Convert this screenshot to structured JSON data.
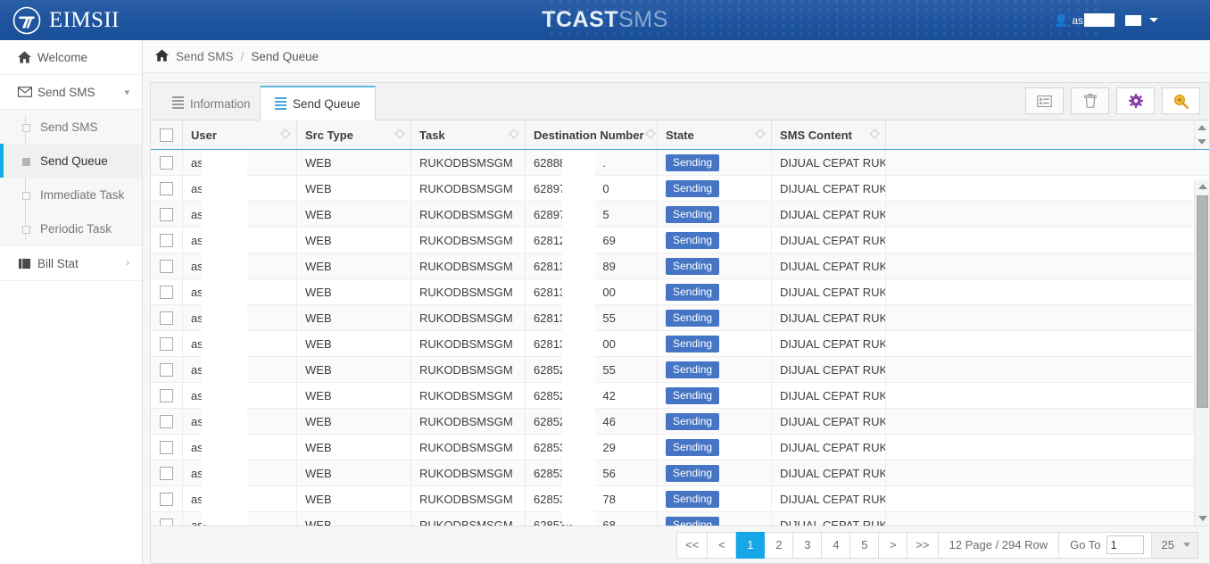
{
  "topbar": {
    "brand_text": "EIMSII",
    "brand_logo_icon": "circle-t-logo-icon",
    "app_title_strong": "TCAST",
    "app_title_light": "SMS",
    "user_icon": "user-icon",
    "user_name_visible": "as",
    "user_caret_icon": "chevron-down-icon"
  },
  "sidebar": {
    "items": [
      {
        "label": "Welcome",
        "icon": "home-icon",
        "chevron": ""
      },
      {
        "label": "Send SMS",
        "icon": "envelope-icon",
        "chevron": "⌄"
      },
      {
        "label": "Bill Stat",
        "icon": "book-icon",
        "chevron": "›"
      }
    ],
    "submenu": [
      {
        "label": "Send SMS",
        "active": false
      },
      {
        "label": "Send Queue",
        "active": true
      },
      {
        "label": "Immediate Task",
        "active": false
      },
      {
        "label": "Periodic Task",
        "active": false
      }
    ]
  },
  "breadcrumb": {
    "home_icon": "home-icon",
    "parent": "Send SMS",
    "separator": "/",
    "current": "Send Queue"
  },
  "tabs": [
    {
      "label": "Information",
      "icon": "list-icon",
      "active": false
    },
    {
      "label": "Send Queue",
      "icon": "list-icon",
      "active": true
    }
  ],
  "toolbar": {
    "buttons": [
      {
        "name": "detail-view-button",
        "icon": "list-detail-icon",
        "color": "#9a9a9a"
      },
      {
        "name": "delete-button",
        "icon": "trash-icon",
        "color": "#9a9a9a"
      },
      {
        "name": "settings-button",
        "icon": "gear-icon",
        "color": "#8e3fa8"
      },
      {
        "name": "search-button",
        "icon": "search-zoom-icon",
        "color": "#e0a800"
      }
    ]
  },
  "table": {
    "select_all_checkbox": "unchecked",
    "columns": [
      {
        "key": "user",
        "label": "User",
        "sortable": true
      },
      {
        "key": "src_type",
        "label": "Src Type",
        "sortable": true
      },
      {
        "key": "task",
        "label": "Task",
        "sortable": true
      },
      {
        "key": "destination_number",
        "label": "Destination Number",
        "sortable": true
      },
      {
        "key": "state",
        "label": "State",
        "sortable": true
      },
      {
        "key": "sms_content",
        "label": "SMS Content",
        "sortable": true
      }
    ],
    "rows": [
      {
        "user": "asi",
        "src_type": "WEB",
        "task": "RUKODBSMSGM",
        "dest_prefix": "628889",
        "dest_suffix": ".",
        "state": "Sending",
        "sms_content": "DIJUAL CEPAT RUK..."
      },
      {
        "user": "asi",
        "src_type": "WEB",
        "task": "RUKODBSMSGM",
        "dest_prefix": "628977",
        "dest_suffix": "0",
        "state": "Sending",
        "sms_content": "DIJUAL CEPAT RUK..."
      },
      {
        "user": "asi",
        "src_type": "WEB",
        "task": "RUKODBSMSGM",
        "dest_prefix": "628979",
        "dest_suffix": "5",
        "state": "Sending",
        "sms_content": "DIJUAL CEPAT RUK..."
      },
      {
        "user": "asi",
        "src_type": "WEB",
        "task": "RUKODBSMSGM",
        "dest_prefix": "628128",
        "dest_suffix": "69",
        "state": "Sending",
        "sms_content": "DIJUAL CEPAT RUK..."
      },
      {
        "user": "asi",
        "src_type": "WEB",
        "task": "RUKODBSMSGM",
        "dest_prefix": "628133",
        "dest_suffix": "89",
        "state": "Sending",
        "sms_content": "DIJUAL CEPAT RUK..."
      },
      {
        "user": "asi",
        "src_type": "WEB",
        "task": "RUKODBSMSGM",
        "dest_prefix": "628134",
        "dest_suffix": "00",
        "state": "Sending",
        "sms_content": "DIJUAL CEPAT RUK..."
      },
      {
        "user": "asi",
        "src_type": "WEB",
        "task": "RUKODBSMSGM",
        "dest_prefix": "628134",
        "dest_suffix": "55",
        "state": "Sending",
        "sms_content": "DIJUAL CEPAT RUK..."
      },
      {
        "user": "asi",
        "src_type": "WEB",
        "task": "RUKODBSMSGM",
        "dest_prefix": "628134",
        "dest_suffix": "00",
        "state": "Sending",
        "sms_content": "DIJUAL CEPAT RUK..."
      },
      {
        "user": "asi",
        "src_type": "WEB",
        "task": "RUKODBSMSGM",
        "dest_prefix": "628526",
        "dest_suffix": "55",
        "state": "Sending",
        "sms_content": "DIJUAL CEPAT RUK..."
      },
      {
        "user": "asi",
        "src_type": "WEB",
        "task": "RUKODBSMSGM",
        "dest_prefix": "628527",
        "dest_suffix": "42",
        "state": "Sending",
        "sms_content": "DIJUAL CEPAT RUK..."
      },
      {
        "user": "asi",
        "src_type": "WEB",
        "task": "RUKODBSMSGM",
        "dest_prefix": "628529",
        "dest_suffix": "46",
        "state": "Sending",
        "sms_content": "DIJUAL CEPAT RUK..."
      },
      {
        "user": "asi",
        "src_type": "WEB",
        "task": "RUKODBSMSGM",
        "dest_prefix": "628531",
        "dest_suffix": "29",
        "state": "Sending",
        "sms_content": "DIJUAL CEPAT RUK..."
      },
      {
        "user": "asi",
        "src_type": "WEB",
        "task": "RUKODBSMSGM",
        "dest_prefix": "628532",
        "dest_suffix": "56",
        "state": "Sending",
        "sms_content": "DIJUAL CEPAT RUK..."
      },
      {
        "user": "asi",
        "src_type": "WEB",
        "task": "RUKODBSMSGM",
        "dest_prefix": "628533",
        "dest_suffix": "78",
        "state": "Sending",
        "sms_content": "DIJUAL CEPAT RUK..."
      },
      {
        "user": "asi",
        "src_type": "WEB",
        "task": "RUKODBSMSGM",
        "dest_prefix": "628535",
        "dest_suffix": "68",
        "state": "Sending",
        "sms_content": "DIJUAL CEPAT RUK"
      }
    ]
  },
  "pagination": {
    "first_label": "<<",
    "prev_label": "<",
    "pages": [
      "1",
      "2",
      "3",
      "4",
      "5"
    ],
    "active_page": "1",
    "next_label": ">",
    "last_label": ">>",
    "summary": "12 Page / 294 Row",
    "goto_label": "Go To",
    "goto_value": "1",
    "page_size": "25"
  },
  "colors": {
    "accent_blue": "#17a7e8",
    "header_blue": "#1f55a0",
    "badge_blue": "#4575c4",
    "tab_underline": "#4aa3d8",
    "gear_purple": "#8e3fa8",
    "search_yellow": "#e0a800"
  }
}
